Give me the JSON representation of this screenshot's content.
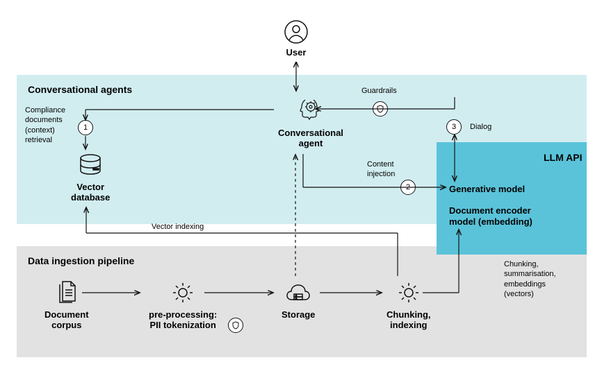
{
  "nodes": {
    "user": "User",
    "conv_agent_line1": "Conversational",
    "conv_agent_line2": "agent",
    "vector_db_line1": "Vector",
    "vector_db_line2": "database",
    "doc_corpus_line1": "Document",
    "doc_corpus_line2": "corpus",
    "preproc_line1": "pre-processing:",
    "preproc_line2": "PII tokenization",
    "storage": "Storage",
    "chunking_line1": "Chunking,",
    "chunking_line2": "indexing",
    "gen_model": "Generative model",
    "encoder_line1": "Document encoder",
    "encoder_line2": "model (embedding)"
  },
  "sections": {
    "conv": "Conversational agents",
    "ingest": "Data ingestion pipeline",
    "llm": "LLM API"
  },
  "labels": {
    "guardrails": "Guardrails",
    "dialog": "Dialog",
    "compliance_l1": "Compliance",
    "compliance_l2": "documents",
    "compliance_l3": "(context)",
    "compliance_l4": "retrieval",
    "content_inj_l1": "Content",
    "content_inj_l2": "injection",
    "vector_indexing": "Vector indexing",
    "chunk_sum_l1": "Chunking,",
    "chunk_sum_l2": "summarisation,",
    "chunk_sum_l3": "embeddings",
    "chunk_sum_l4": "(vectors)"
  },
  "steps": {
    "s1": "1",
    "s2": "2",
    "s3": "3"
  }
}
